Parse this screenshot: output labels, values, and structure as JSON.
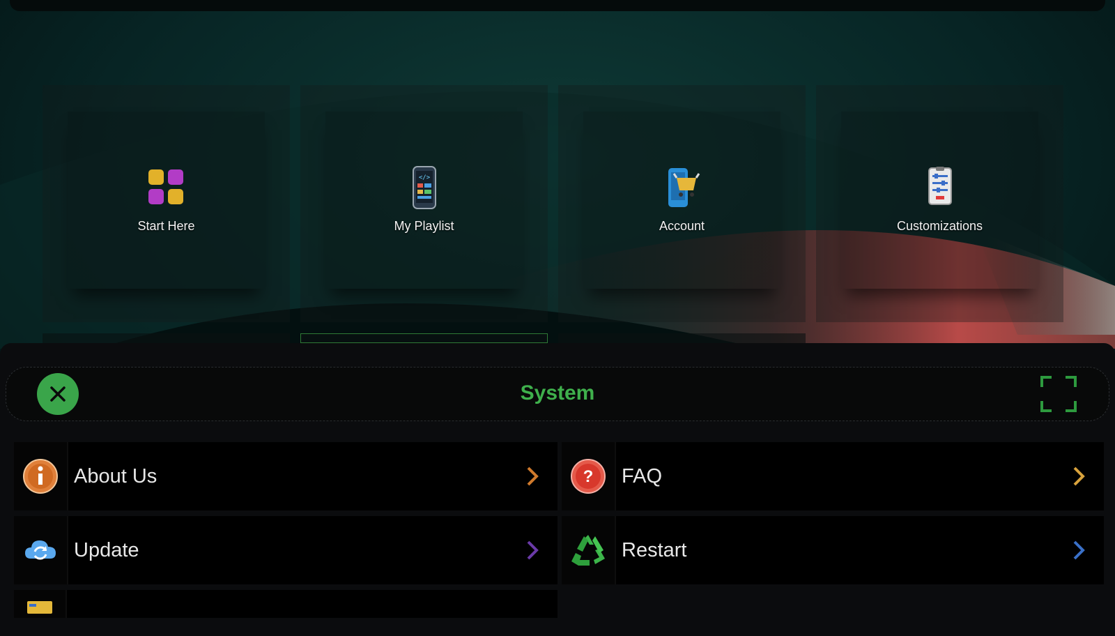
{
  "tiles": [
    {
      "label": "Start Here",
      "icon": "grid-apps-icon"
    },
    {
      "label": "My Playlist",
      "icon": "phone-code-icon"
    },
    {
      "label": "Account",
      "icon": "shopping-cart-phone-icon"
    },
    {
      "label": "Customizations",
      "icon": "settings-list-icon"
    }
  ],
  "panel": {
    "title": "System",
    "items": [
      {
        "label": "About Us",
        "icon": "info-icon",
        "chevron_color": "#d07a2c"
      },
      {
        "label": "FAQ",
        "icon": "question-icon",
        "chevron_color": "#d8a23c"
      },
      {
        "label": "Update",
        "icon": "cloud-update-icon",
        "chevron_color": "#6a3aa8"
      },
      {
        "label": "Restart",
        "icon": "recycle-icon",
        "chevron_color": "#3a70c8"
      }
    ]
  },
  "colors": {
    "accent_green": "#3fb04c",
    "panel_bg": "#0b0c0e"
  }
}
